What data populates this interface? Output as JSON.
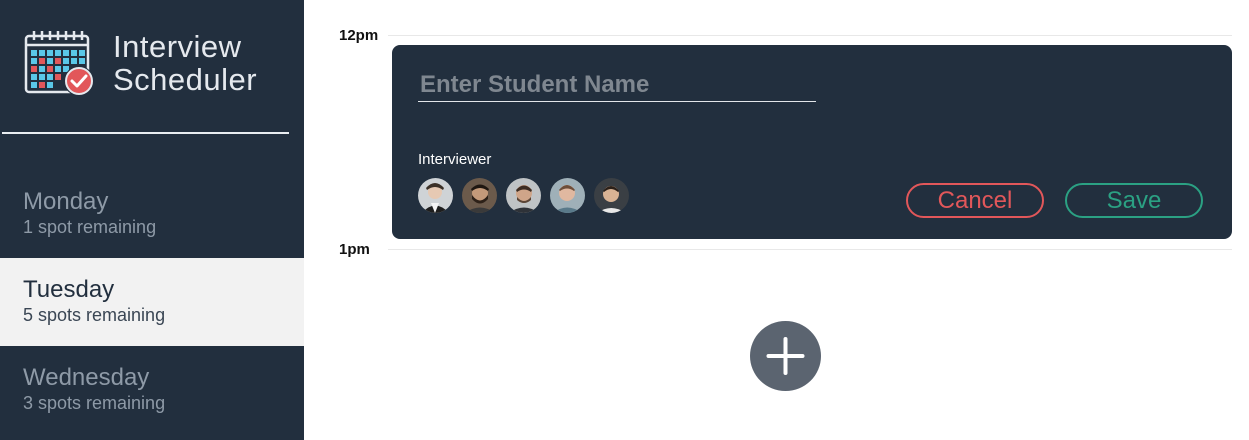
{
  "app": {
    "title_line1": "Interview",
    "title_line2": "Scheduler"
  },
  "sidebar": {
    "days": [
      {
        "name": "Monday",
        "spots": "1 spot remaining",
        "selected": false
      },
      {
        "name": "Tuesday",
        "spots": "5 spots remaining",
        "selected": true
      },
      {
        "name": "Wednesday",
        "spots": "3 spots remaining",
        "selected": false
      }
    ]
  },
  "schedule": {
    "times": [
      "12pm",
      "1pm"
    ]
  },
  "form": {
    "student_placeholder": "Enter Student Name",
    "student_value": "",
    "interviewer_label": "Interviewer",
    "interviewers": [
      "interviewer-1",
      "interviewer-2",
      "interviewer-3",
      "interviewer-4",
      "interviewer-5"
    ],
    "cancel_label": "Cancel",
    "save_label": "Save"
  },
  "colors": {
    "sidebar_bg": "#222f3e",
    "cancel": "#e2575a",
    "save": "#2ba183",
    "add_button": "#5b6470"
  },
  "icons": {
    "logo": "calendar-check-icon",
    "add": "plus-icon"
  }
}
